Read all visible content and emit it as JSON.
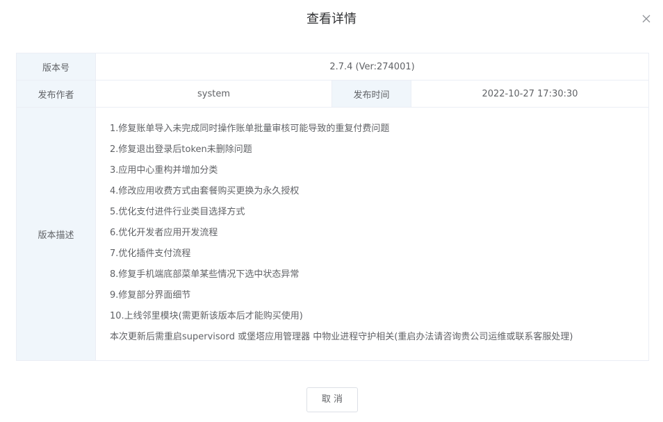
{
  "dialog": {
    "title": "查看详情",
    "close_icon": "close-icon"
  },
  "details": {
    "version_label": "版本号",
    "version_value": "2.7.4 (Ver:274001)",
    "author_label": "发布作者",
    "author_value": "system",
    "time_label": "发布时间",
    "time_value": "2022-10-27 17:30:30",
    "desc_label": "版本描述",
    "desc_lines": [
      "1.修复账单导入未完成同时操作账单批量审核可能导致的重复付费问题",
      "2.修复退出登录后token未删除问题",
      "3.应用中心重构并增加分类",
      "4.修改应用收费方式由套餐购买更换为永久授权",
      "5.优化支付进件行业类目选择方式",
      "6.优化开发者应用开发流程",
      "7.优化插件支付流程",
      "8.修复手机端底部菜单某些情况下选中状态异常",
      "9.修复部分界面细节",
      "10.上线邻里模块(需更新该版本后才能购买使用)",
      "本次更新后需重启supervisord 或堡塔应用管理器 中物业进程守护相关(重启办法请咨询贵公司运维或联系客服处理)"
    ]
  },
  "footer": {
    "cancel_label": "取 消"
  }
}
